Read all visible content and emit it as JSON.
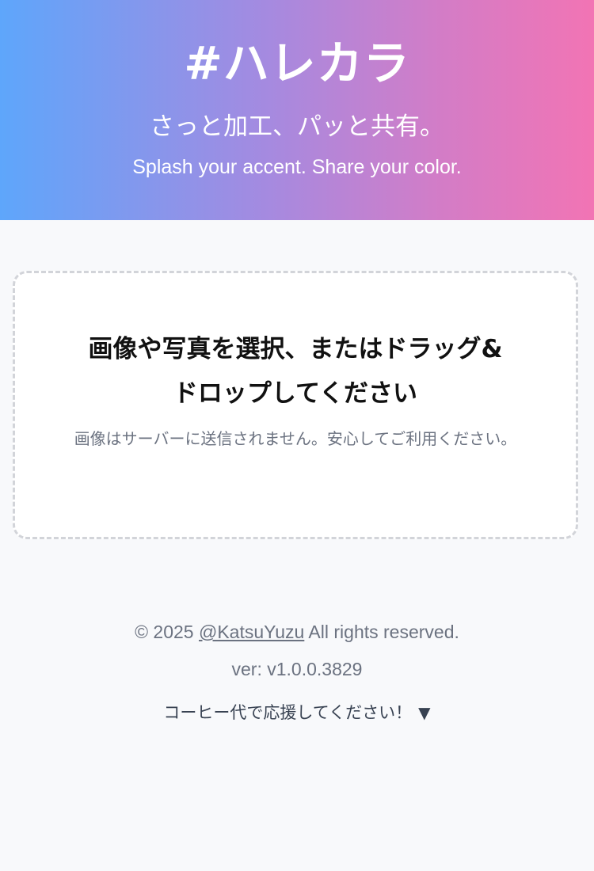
{
  "header": {
    "title": "#ハレカラ",
    "tagline_ja": "さっと加工、パッと共有。",
    "tagline_en": "Splash your accent. Share your color."
  },
  "dropzone": {
    "title_line1": "画像や写真を選択、またはドラッグ&",
    "title_line2": "ドロップしてください",
    "note": "画像はサーバーに送信されません。安心してご利用ください。"
  },
  "footer": {
    "copyright_prefix": "© 2025 ",
    "author_link": "@KatsuYuzu",
    "copyright_suffix": " All rights reserved.",
    "version": "ver: v1.0.0.3829",
    "support_label": "コーヒー代で応援してください！",
    "support_caret": "▼"
  },
  "colors": {
    "gradient_start": "#5ea6fb",
    "gradient_end": "#f274b4",
    "background": "#f8f9fb"
  },
  "icons": {
    "support_toggle": "triangle-down-icon"
  }
}
